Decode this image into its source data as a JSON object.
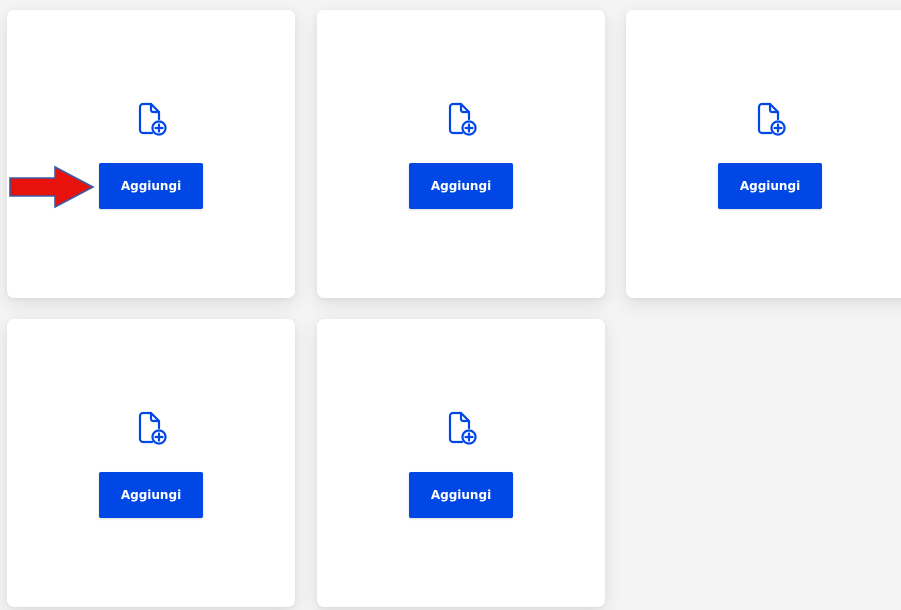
{
  "theme": {
    "button_color": "#0047e6",
    "icon_color": "#0047e6",
    "arrow_fill": "#e8120c",
    "arrow_stroke": "#3a5ba8"
  },
  "annotation": {
    "icon": "red-arrow-icon"
  },
  "cards": [
    {
      "icon": "file-add-icon",
      "button_label": "Aggiungi"
    },
    {
      "icon": "file-add-icon",
      "button_label": "Aggiungi"
    },
    {
      "icon": "file-add-icon",
      "button_label": "Aggiungi"
    },
    {
      "icon": "file-add-icon",
      "button_label": "Aggiungi"
    },
    {
      "icon": "file-add-icon",
      "button_label": "Aggiungi"
    }
  ]
}
